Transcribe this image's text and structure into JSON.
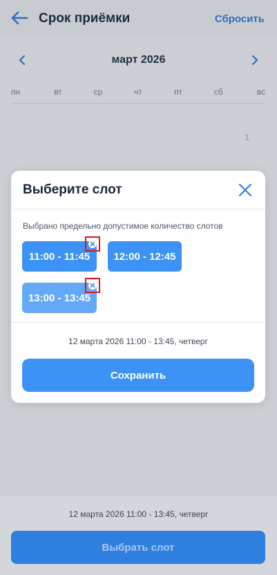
{
  "header": {
    "title": "Срок приёмки",
    "reset_label": "Сбросить",
    "back_icon": "arrow-left-icon"
  },
  "calendar": {
    "month_label": "март 2026",
    "weekdays": [
      "пн",
      "вт",
      "ср",
      "чт",
      "пт",
      "сб",
      "вс"
    ],
    "visible_days": [
      "1"
    ]
  },
  "modal": {
    "title": "Выберите слот",
    "limit_message": "Выбрано предельно допустимое количество слотов",
    "slots": [
      {
        "label": "11:00 - 11:45",
        "selected": true
      },
      {
        "label": "12:00 - 12:45",
        "selected": false
      },
      {
        "label": "13:00 - 13:45",
        "selected": true
      }
    ],
    "summary": "12 марта 2026 11:00 - 13:45, четверг",
    "save_label": "Сохранить"
  },
  "footer": {
    "summary": "12 марта 2026 11:00 - 13:45, четверг",
    "select_label": "Выбрать слот"
  },
  "colors": {
    "accent": "#3d92f5",
    "link": "#2f6fc8",
    "highlight": "#e01414"
  }
}
